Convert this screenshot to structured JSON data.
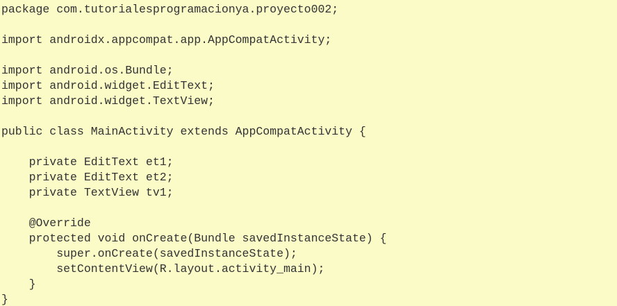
{
  "code": {
    "lines": [
      "package com.tutorialesprogramacionya.proyecto002;",
      "",
      "import androidx.appcompat.app.AppCompatActivity;",
      "",
      "import android.os.Bundle;",
      "import android.widget.EditText;",
      "import android.widget.TextView;",
      "",
      "public class MainActivity extends AppCompatActivity {",
      "",
      "    private EditText et1;",
      "    private EditText et2;",
      "    private TextView tv1;",
      "",
      "    @Override",
      "    protected void onCreate(Bundle savedInstanceState) {",
      "        super.onCreate(savedInstanceState);",
      "        setContentView(R.layout.activity_main);",
      "    }",
      "}"
    ]
  },
  "colors": {
    "background": "#fbfbc7",
    "text": "#333333"
  }
}
